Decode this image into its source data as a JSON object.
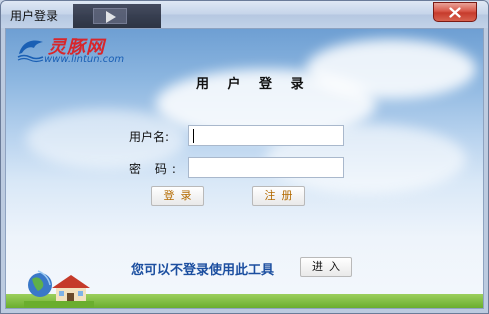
{
  "window": {
    "title": "用户登录"
  },
  "logo": {
    "name": "灵豚网",
    "url": "www.lintun.com"
  },
  "heading": "用 户 登 录",
  "form": {
    "username_label": "用户名:",
    "username_value": "",
    "password_label": "密 码:",
    "password_value": ""
  },
  "buttons": {
    "login": "登录",
    "register": "注册",
    "enter": "进入"
  },
  "guest_note": "您可以不登录使用此工具",
  "colors": {
    "close_red": "#c63b2c",
    "logo_red": "#d8262b",
    "note_blue": "#1c4fa0",
    "button_text": "#b36a00"
  },
  "icons": [
    "close-icon",
    "dolphin-logo-icon",
    "globe-house-icon"
  ]
}
